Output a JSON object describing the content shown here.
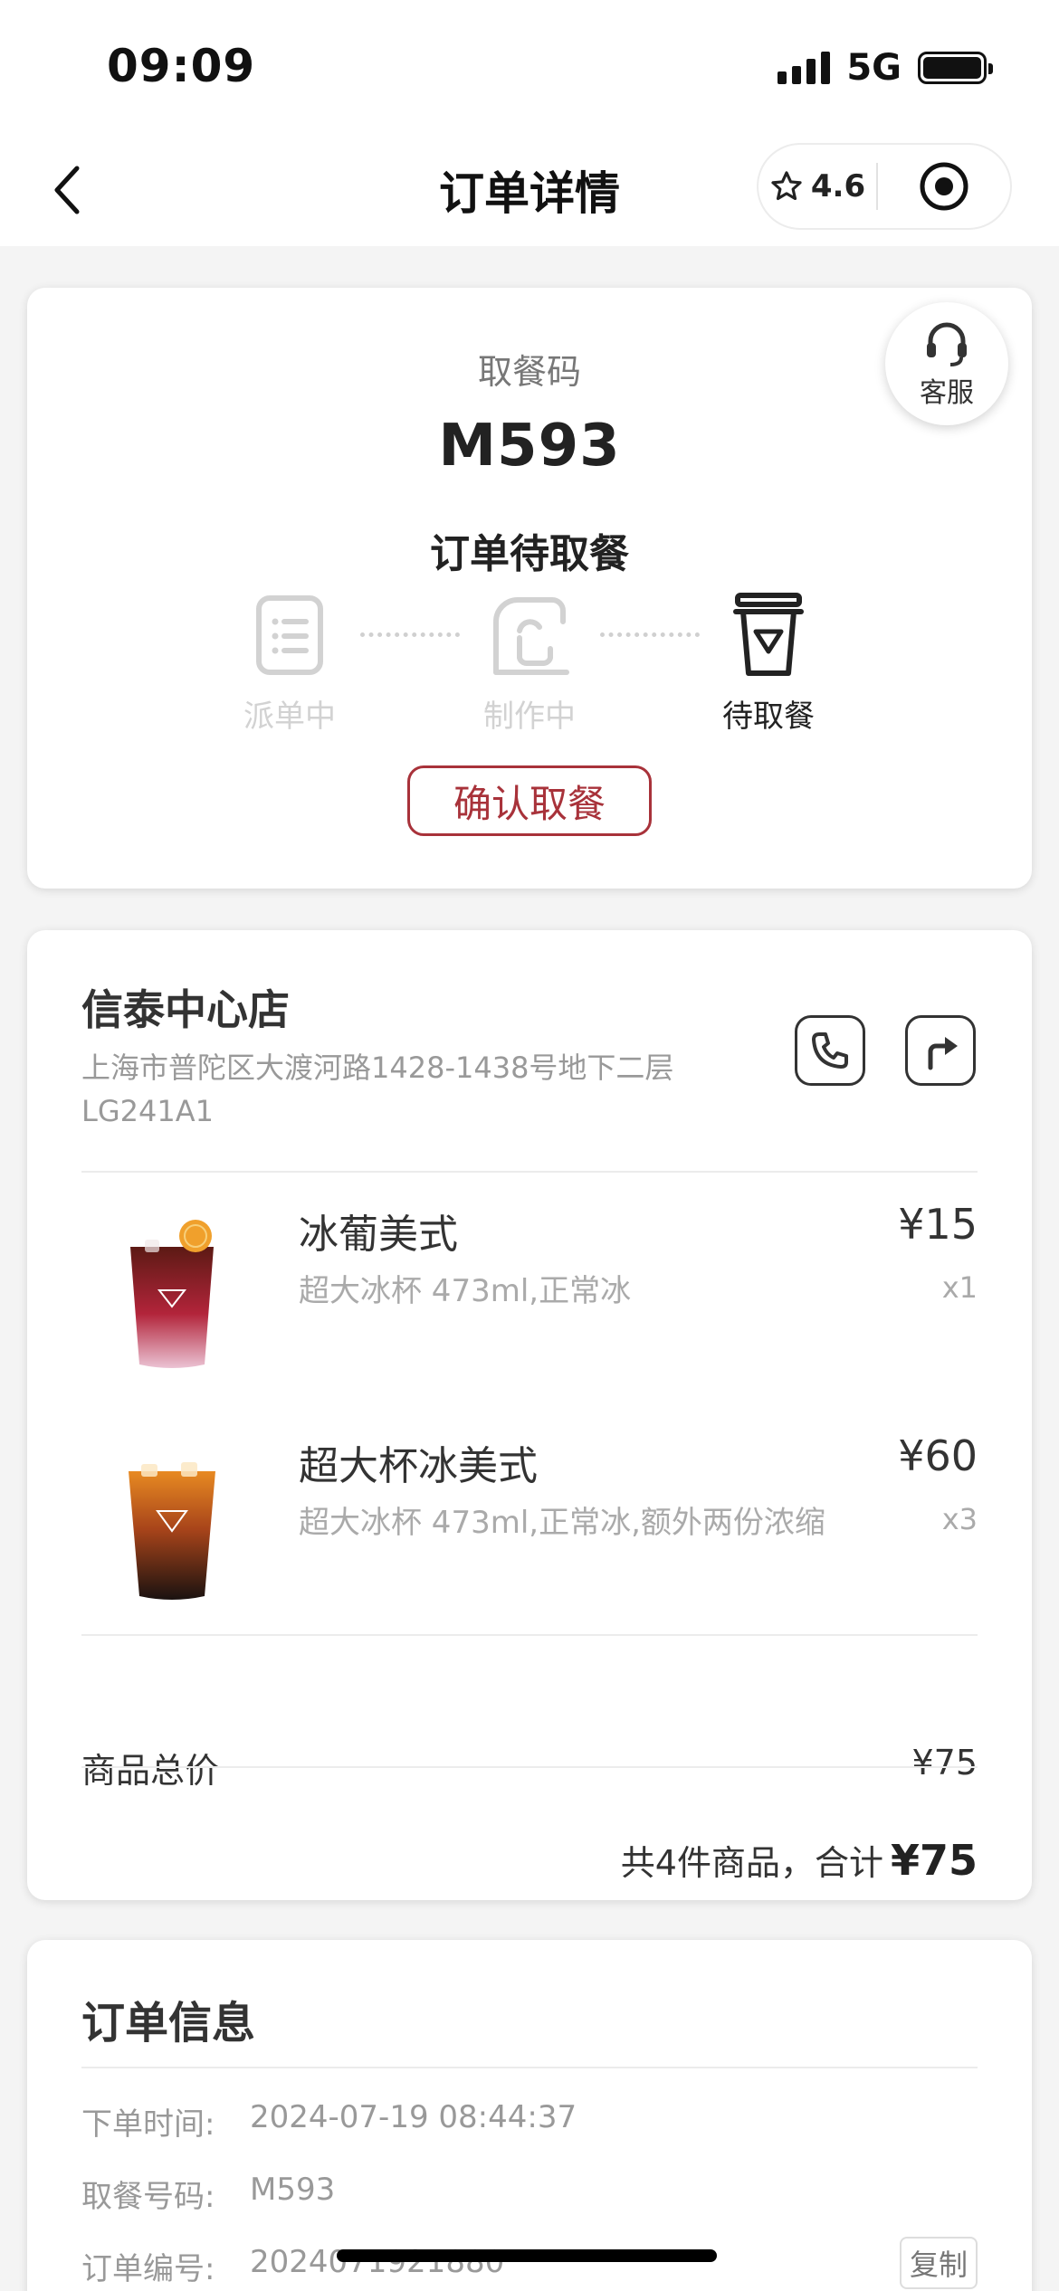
{
  "status_bar": {
    "time": "09:09",
    "network": "5G"
  },
  "nav": {
    "title": "订单详情",
    "rating": "4.6"
  },
  "pickup": {
    "label": "取餐码",
    "code": "M593",
    "status": "订单待取餐",
    "service_label": "客服",
    "steps": [
      {
        "label": "派单中",
        "state": "inactive",
        "icon": "order-list-icon"
      },
      {
        "label": "制作中",
        "state": "inactive",
        "icon": "coffee-machine-icon"
      },
      {
        "label": "待取餐",
        "state": "active",
        "icon": "pickup-cup-icon"
      }
    ],
    "confirm_label": "确认取餐",
    "accent_color": "#a8323a"
  },
  "store": {
    "name": "信泰中心店",
    "address": "上海市普陀区大渡河路1428-1438号地下二层LG241A1",
    "items": [
      {
        "name": "冰葡美式",
        "options": "超大冰杯 473ml,正常冰",
        "price": "¥15",
        "qty": "x1"
      },
      {
        "name": "超大杯冰美式",
        "options": "超大冰杯 473ml,正常冰,额外两份浓缩",
        "price": "¥60",
        "qty": "x3"
      }
    ],
    "subtotal_label": "商品总价",
    "subtotal_value": "¥75",
    "summary_prefix": "共4件商品，合计",
    "summary_total": "¥75"
  },
  "order_info": {
    "title": "订单信息",
    "rows": [
      {
        "key": "下单时间:",
        "value": "2024-07-19 08:44:37"
      },
      {
        "key": "取餐号码:",
        "value": "M593"
      },
      {
        "key": "订单编号:",
        "value": "2024071921880"
      }
    ],
    "copy_label": "复制"
  }
}
